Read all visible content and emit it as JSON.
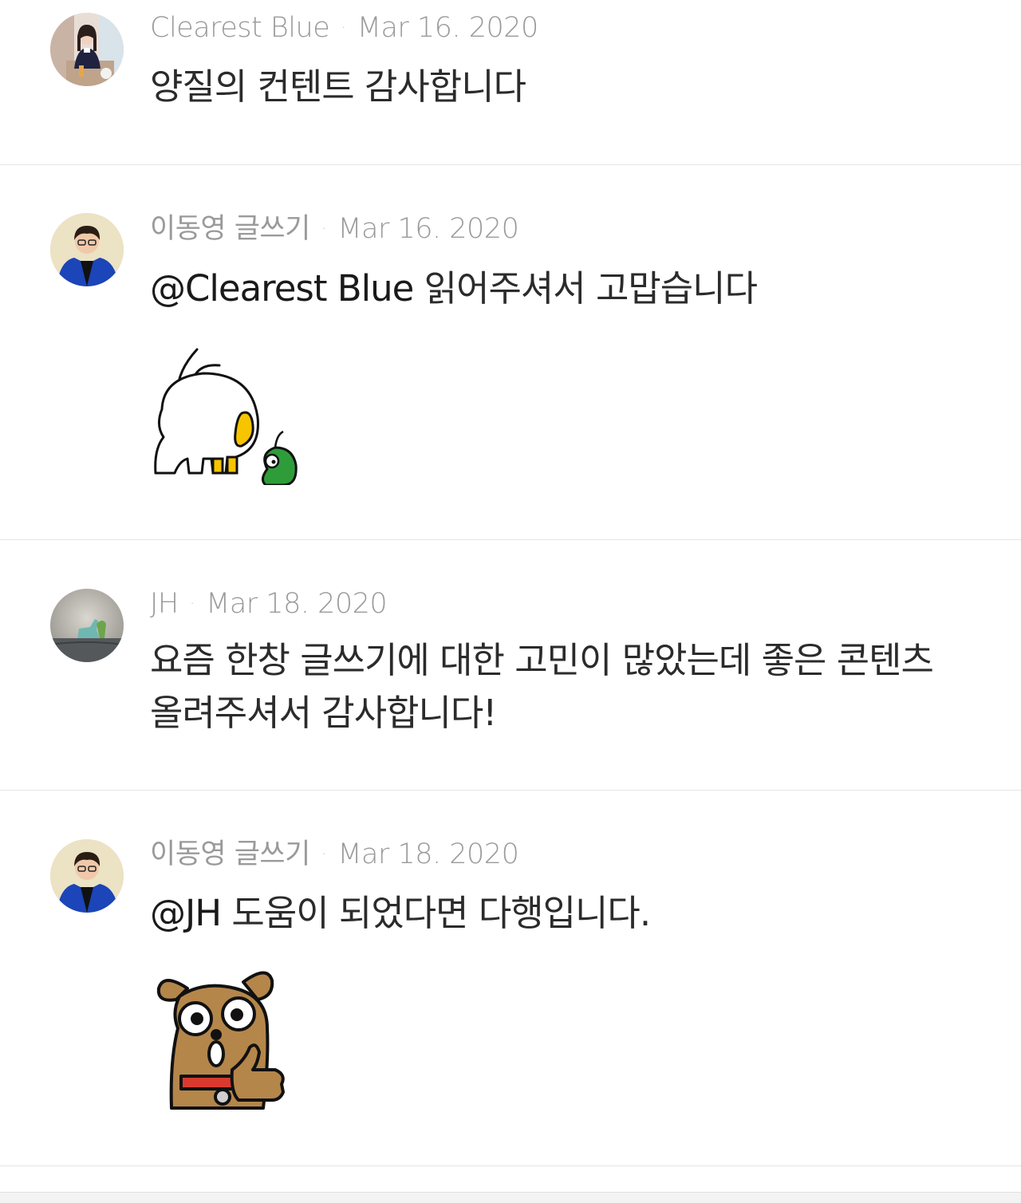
{
  "comments": [
    {
      "author": "Clearest Blue",
      "date": "Mar 16. 2020",
      "text": "양질의 컨텐트 감사합니다"
    },
    {
      "author": "이동영 글쓰기",
      "date": "Mar 16. 2020",
      "mention": "@Clearest Blue",
      "text": "읽어주셔서 고맙습니다",
      "sticker": "rabbit-duck-sticker"
    },
    {
      "author": "JH",
      "date": "Mar 18. 2020",
      "text_line1": "요즘 한창 글쓰기에 대한 고민이 많았는데 좋은 콘텐츠",
      "text_line2": "올려주셔서 감사합니다!"
    },
    {
      "author": "이동영 글쓰기",
      "date": "Mar 18. 2020",
      "mention": "@JH",
      "text": "도움이 되었다면 다행입니다.",
      "sticker": "frodo-dog-thumbs-up-sticker"
    }
  ],
  "dot": "·",
  "colors": {
    "meta_text": "#9a9a9a",
    "body_text": "#2b2b2b",
    "divider": "#e6e6e6"
  }
}
